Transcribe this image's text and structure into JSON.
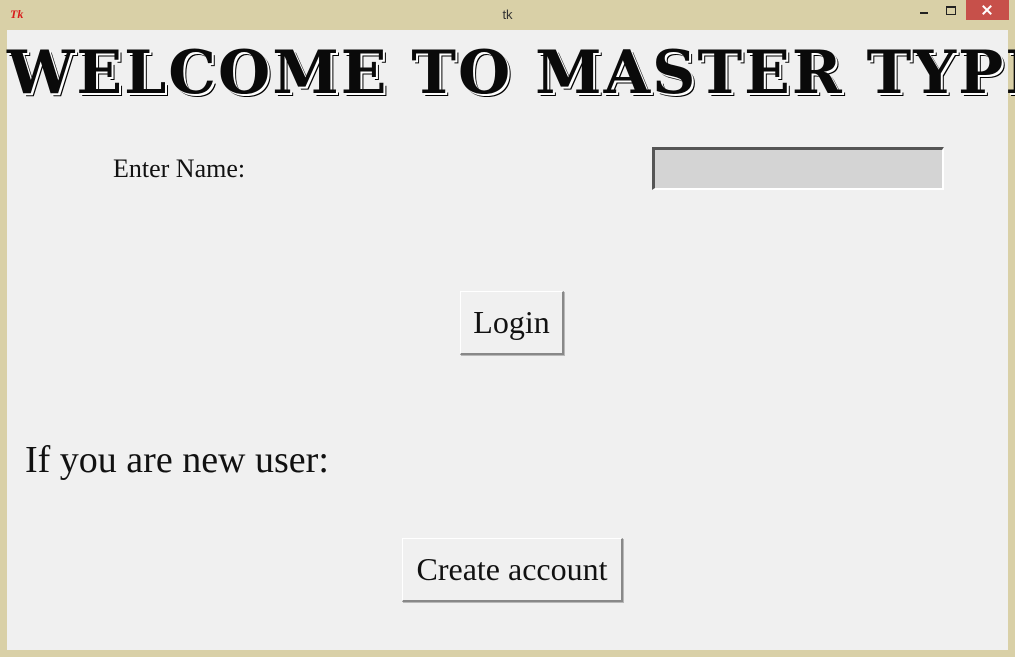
{
  "window": {
    "icon_text": "Tk",
    "title": "tk"
  },
  "heading": "WELCOME TO MASTER TYPE",
  "login": {
    "name_label": "Enter Name:",
    "name_value": "",
    "login_label": "Login"
  },
  "signup": {
    "prompt": "If you are new user:",
    "create_label": "Create account"
  }
}
